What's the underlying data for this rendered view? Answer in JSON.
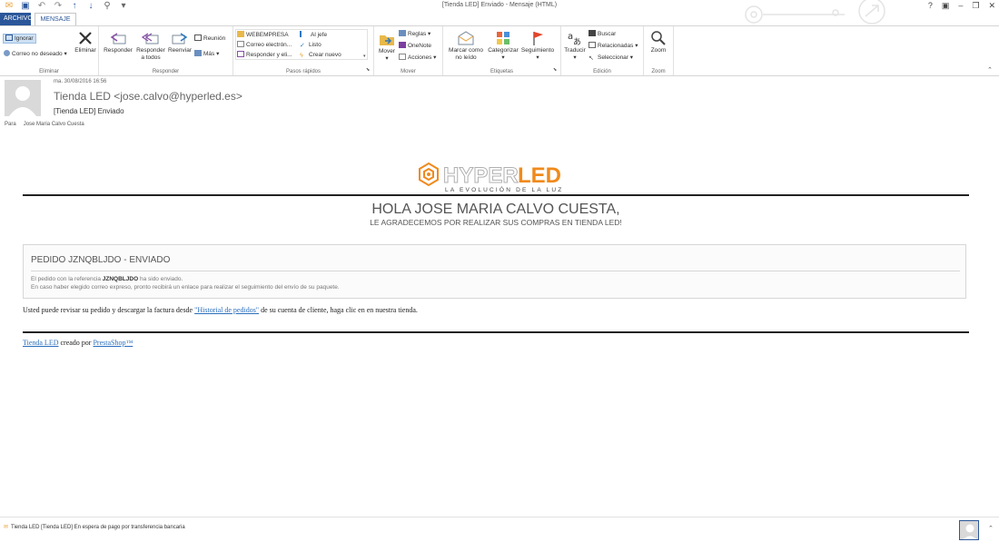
{
  "window": {
    "title": "[Tienda LED] Enviado - Mensaje (HTML)",
    "controls": {
      "help": "?",
      "ribbon_opts": "▣",
      "minimize": "–",
      "restore": "❐",
      "close": "✕"
    }
  },
  "qat": {
    "icons": [
      "mail-icon",
      "save-icon",
      "undo-icon",
      "redo-icon",
      "up-arrow-icon",
      "down-arrow-icon",
      "attachment-icon",
      "customize-icon"
    ]
  },
  "tabs": {
    "archivo": "ARCHIVO",
    "mensaje": "MENSAJE"
  },
  "ribbon": {
    "eliminar": {
      "ignorar": "Ignorar",
      "correo_no_deseado": "Correo no deseado",
      "eliminar": "Eliminar",
      "label": "Eliminar"
    },
    "responder": {
      "responder": "Responder",
      "responder_todos_1": "Responder",
      "responder_todos_2": "a todos",
      "reenviar": "Reenviar",
      "reunion": "Reunión",
      "mas": "Más",
      "label": "Responder"
    },
    "pasos": {
      "items": [
        "WEBEMPRESA",
        "Al jefe",
        "Correo electrón...",
        "Listo",
        "Responder y eli...",
        "Crear nuevo"
      ],
      "label": "Pasos rápidos"
    },
    "mover": {
      "mover": "Mover",
      "reglas": "Reglas",
      "onenote": "OneNote",
      "acciones": "Acciones",
      "label": "Mover"
    },
    "etiquetas": {
      "marcar_1": "Marcar como",
      "marcar_2": "no leído",
      "categorizar": "Categorizar",
      "seguimiento": "Seguimiento",
      "label": "Etiquetas"
    },
    "edicion": {
      "traducir": "Traducir",
      "buscar": "Buscar",
      "relacionadas": "Relacionadas",
      "seleccionar": "Seleccionar",
      "label": "Edición"
    },
    "zoom": {
      "zoom": "Zoom",
      "label": "Zoom"
    }
  },
  "message": {
    "date": "ma. 30/08/2016 16:56",
    "sender": "Tienda LED <jose.calvo@hyperled.es>",
    "subject": "[Tienda LED] Enviado",
    "to_label": "Para",
    "to": "Jose Maria Calvo Cuesta"
  },
  "body": {
    "logo_a": "HYPER",
    "logo_b": "LED",
    "logo_tagline": "LA EVOLUCIÓN DE LA LUZ",
    "greeting": "HOLA JOSE MARIA CALVO CUESTA,",
    "thanks": "LE AGRADECEMOS POR REALIZAR SUS COMPRAS EN TIENDA LED!",
    "order_title": "PEDIDO JZNQBLJDO - ENVIADO",
    "order_line1_a": "El pedido con la referencia ",
    "order_ref": "JZNQBLJDO",
    "order_line1_b": " ha sido enviado.",
    "order_line2": "En caso haber elegido correo expreso, pronto recibirá un enlace para realizar el seguimiento del envío de su paquete.",
    "revisar_a": "Usted puede revisar su pedido y descargar la factura desde ",
    "revisar_link": "\"Historial de pedidos\"",
    "revisar_b": " de su cuenta de cliente, haga clic en en nuestra tienda.",
    "footer_link1": "Tienda LED",
    "footer_mid": " creado por ",
    "footer_link2": "PrestaShop™"
  },
  "status": {
    "text": "Tienda LED  [Tienda LED] En espera de pago por transferencia bancaria"
  },
  "colors": {
    "accent": "#2b579a",
    "logo_orange": "#f08a1c",
    "logo_gray": "#b0b0b0"
  }
}
